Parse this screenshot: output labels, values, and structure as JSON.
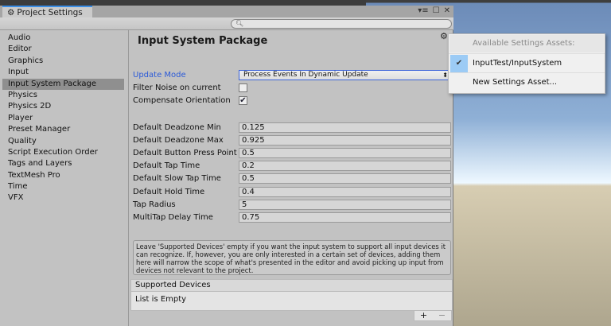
{
  "window": {
    "tab_title": "Project Settings",
    "search_placeholder": ""
  },
  "sidebar": {
    "items": [
      {
        "label": "Audio"
      },
      {
        "label": "Editor"
      },
      {
        "label": "Graphics"
      },
      {
        "label": "Input"
      },
      {
        "label": "Input System Package",
        "selected": true
      },
      {
        "label": "Physics"
      },
      {
        "label": "Physics 2D"
      },
      {
        "label": "Player"
      },
      {
        "label": "Preset Manager"
      },
      {
        "label": "Quality"
      },
      {
        "label": "Script Execution Order"
      },
      {
        "label": "Tags and Layers"
      },
      {
        "label": "TextMesh Pro"
      },
      {
        "label": "Time"
      },
      {
        "label": "VFX"
      }
    ]
  },
  "main": {
    "title": "Input System Package",
    "update_mode": {
      "label": "Update Mode",
      "value": "Process Events In Dynamic Update"
    },
    "filter_noise": {
      "label": "Filter Noise on current",
      "checked": false
    },
    "compensate": {
      "label": "Compensate Orientation",
      "checked": true,
      "mark": "✔"
    },
    "fields": [
      {
        "label": "Default Deadzone Min",
        "value": "0.125"
      },
      {
        "label": "Default Deadzone Max",
        "value": "0.925"
      },
      {
        "label": "Default Button Press Point",
        "value": "0.5"
      },
      {
        "label": "Default Tap Time",
        "value": "0.2"
      },
      {
        "label": "Default Slow Tap Time",
        "value": "0.5"
      },
      {
        "label": "Default Hold Time",
        "value": "0.4"
      },
      {
        "label": "Tap Radius",
        "value": "5"
      },
      {
        "label": "MultiTap Delay Time",
        "value": "0.75"
      }
    ],
    "help_text": "Leave 'Supported Devices' empty if you want the input system to support all input devices it can recognize. If, however, you are only interested in a certain set of devices, adding them here will narrow the scope of what's presented in the editor and avoid picking up input from devices not relevant to the project.",
    "supported_devices": {
      "header": "Supported Devices",
      "empty_text": "List is Empty",
      "add": "+",
      "remove": "−"
    }
  },
  "menu": {
    "header": "Available Settings Assets:",
    "items": [
      {
        "label": "InputTest/InputSystem",
        "checked": true,
        "mark": "✔"
      },
      {
        "label": "New Settings Asset..."
      }
    ]
  },
  "colors": {
    "accent": "#3b8ee6",
    "label_blue": "#2b5ad8",
    "selection": "#9ccbf5"
  }
}
